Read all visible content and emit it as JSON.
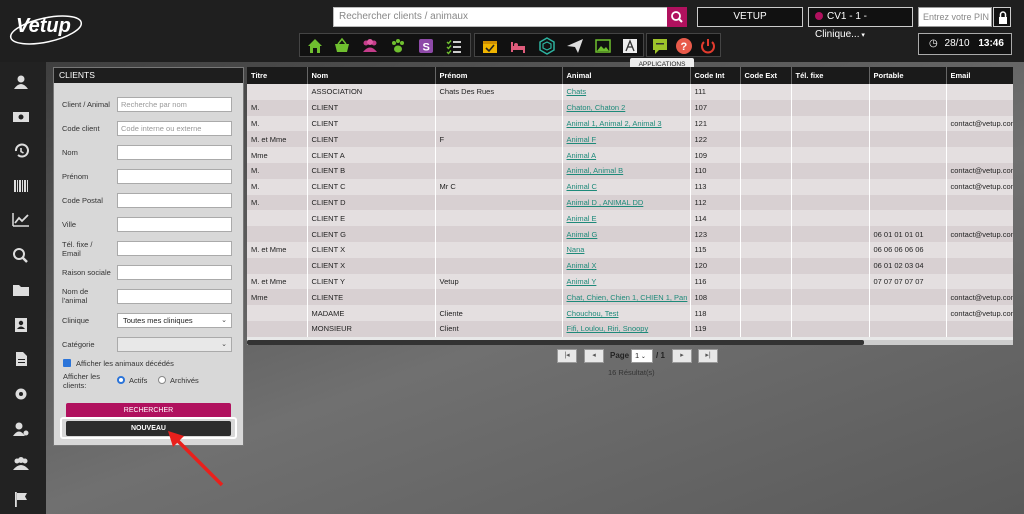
{
  "header": {
    "logo_text": "Vetup",
    "search_placeholder": "Rechercher clients / animaux",
    "vetup_button": "VETUP",
    "clinic_select": "CV1 - 1 - Clinique...",
    "pin_placeholder": "Entrez votre PIN",
    "date": "28/10",
    "time": "13:46",
    "tooltip": "APPLICATIONS",
    "colors": {
      "brand": "#b0115e",
      "accent_green": "#6fbf2f",
      "yellow": "#f0b400",
      "red": "#e23b2e"
    }
  },
  "toolbar_icons": [
    "home-icon",
    "basket-icon",
    "group-icon",
    "paw-icon",
    "s-icon",
    "checklist-icon",
    "calendar-check-icon",
    "bed-icon",
    "hexagon-icon",
    "send-icon",
    "image-icon",
    "appstore-icon",
    "chat-icon",
    "help-icon",
    "power-icon"
  ],
  "sidebar_icons": [
    "users-icon",
    "money-icon",
    "history-icon",
    "barcode-icon",
    "chart-icon",
    "search-icon",
    "folder-icon",
    "contact-icon",
    "document-icon",
    "settings-icon",
    "user-settings-icon",
    "group-icon",
    "flag-icon"
  ],
  "panel": {
    "title": "CLIENTS",
    "fields": [
      {
        "label": "Client / Animal",
        "placeholder": "Recherche par nom"
      },
      {
        "label": "Code client",
        "placeholder": "Code interne ou externe"
      },
      {
        "label": "Nom",
        "placeholder": ""
      },
      {
        "label": "Prénom",
        "placeholder": ""
      },
      {
        "label": "Code Postal",
        "placeholder": ""
      },
      {
        "label": "Ville",
        "placeholder": ""
      },
      {
        "label": "Tél. fixe / Email",
        "placeholder": ""
      },
      {
        "label": "Raison sociale",
        "placeholder": ""
      },
      {
        "label": "Nom de l'animal",
        "placeholder": ""
      }
    ],
    "clinic_label": "Clinique",
    "clinic_value": "Toutes mes cliniques",
    "category_label": "Catégorie",
    "category_value": "",
    "show_deceased_label": "Afficher les animaux décédés",
    "show_clients_label": "Afficher les clients:",
    "radio_active": "Actifs",
    "radio_archived": "Archivés",
    "search_button": "RECHERCHER",
    "new_button": "NOUVEAU"
  },
  "table": {
    "columns": [
      "Titre",
      "Nom",
      "Prénom",
      "Animal",
      "Code Int",
      "Code Ext",
      "Tél. fixe",
      "Portable",
      "Email"
    ],
    "rows": [
      {
        "titre": "",
        "nom": "ASSOCIATION",
        "prenom": "Chats Des Rues",
        "animal": "Chats",
        "code_int": "111",
        "code_ext": "",
        "tel": "",
        "portable": "",
        "email": ""
      },
      {
        "titre": "M.",
        "nom": "CLIENT",
        "prenom": "",
        "animal": "Chaton, Chaton 2",
        "code_int": "107",
        "code_ext": "",
        "tel": "",
        "portable": "",
        "email": ""
      },
      {
        "titre": "M.",
        "nom": "CLIENT",
        "prenom": "",
        "animal": "Animal 1, Animal 2, Animal 3",
        "code_int": "121",
        "code_ext": "",
        "tel": "",
        "portable": "",
        "email": "contact@vetup.com"
      },
      {
        "titre": "M. et Mme",
        "nom": "CLIENT",
        "prenom": "F",
        "animal": "Animal F",
        "code_int": "122",
        "code_ext": "",
        "tel": "",
        "portable": "",
        "email": ""
      },
      {
        "titre": "Mme",
        "nom": "CLIENT A",
        "prenom": "",
        "animal": "Animal A",
        "code_int": "109",
        "code_ext": "",
        "tel": "",
        "portable": "",
        "email": ""
      },
      {
        "titre": "M.",
        "nom": "CLIENT B",
        "prenom": "",
        "animal": "Animal, Animal B",
        "code_int": "110",
        "code_ext": "",
        "tel": "",
        "portable": "",
        "email": "contact@vetup.com"
      },
      {
        "titre": "M.",
        "nom": "CLIENT C",
        "prenom": "Mr C",
        "animal": "Animal C",
        "code_int": "113",
        "code_ext": "",
        "tel": "",
        "portable": "",
        "email": "contact@vetup.com"
      },
      {
        "titre": "M.",
        "nom": "CLIENT D",
        "prenom": "",
        "animal": "Animal D , ANIMAL DD",
        "code_int": "112",
        "code_ext": "",
        "tel": "",
        "portable": "",
        "email": ""
      },
      {
        "titre": "",
        "nom": "CLIENT E",
        "prenom": "",
        "animal": "Animal E",
        "code_int": "114",
        "code_ext": "",
        "tel": "",
        "portable": "",
        "email": ""
      },
      {
        "titre": "",
        "nom": "CLIENT G",
        "prenom": "",
        "animal": "Animal G",
        "code_int": "123",
        "code_ext": "",
        "tel": "",
        "portable": "06 01 01 01 01",
        "email": "contact@vetup.com"
      },
      {
        "titre": "M. et Mme",
        "nom": "CLIENT X",
        "prenom": "",
        "animal": "Nana",
        "code_int": "115",
        "code_ext": "",
        "tel": "",
        "portable": "06 06 06 06 06",
        "email": ""
      },
      {
        "titre": "",
        "nom": "CLIENT X",
        "prenom": "",
        "animal": "Animal X",
        "code_int": "120",
        "code_ext": "",
        "tel": "",
        "portable": "06 01 02 03 04",
        "email": ""
      },
      {
        "titre": "M. et Mme",
        "nom": "CLIENT Y",
        "prenom": "Vetup",
        "animal": "Animal Y",
        "code_int": "116",
        "code_ext": "",
        "tel": "",
        "portable": "07 07 07 07 07",
        "email": ""
      },
      {
        "titre": "Mme",
        "nom": "CLIENTE",
        "prenom": "",
        "animal": "Chat, Chien, Chien 1, CHIEN 1, Pan",
        "code_int": "108",
        "code_ext": "",
        "tel": "",
        "portable": "",
        "email": "contact@vetup.com"
      },
      {
        "titre": "",
        "nom": "MADAME",
        "prenom": "Cliente",
        "animal": "Chouchou, Test",
        "code_int": "118",
        "code_ext": "",
        "tel": "",
        "portable": "",
        "email": "contact@vetup.com"
      },
      {
        "titre": "",
        "nom": "MONSIEUR",
        "prenom": "Client",
        "animal": "Fifi, Loulou, Riri, Snoopy",
        "code_int": "119",
        "code_ext": "",
        "tel": "",
        "portable": "",
        "email": ""
      }
    ]
  },
  "pagination": {
    "page_label": "Page",
    "page_value": "1",
    "total": "/ 1",
    "results": "16 Résultat(s)"
  }
}
